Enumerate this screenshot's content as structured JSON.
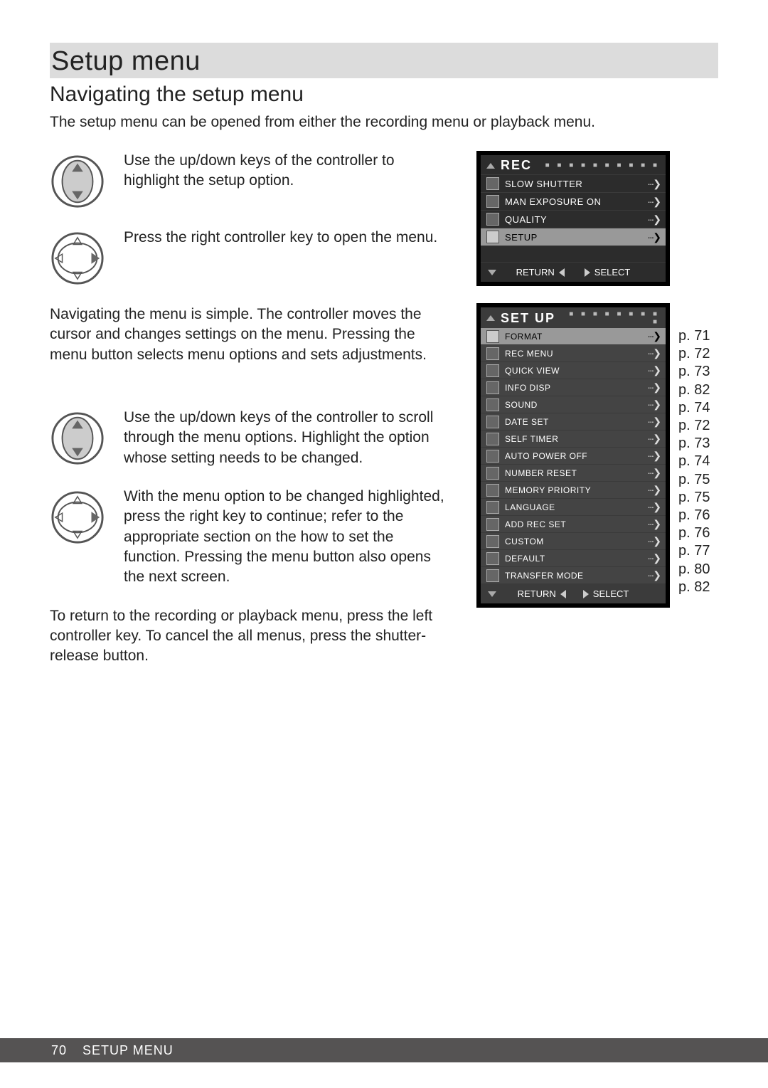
{
  "page": {
    "title": "Setup menu",
    "subtitle": "Navigating the setup menu",
    "intro": "The setup menu can be opened from either the recording menu or playback menu.",
    "step1": "Use the up/down keys of the controller to highlight the setup option.",
    "step2": "Press the right controller key to open the menu.",
    "para1": "Navigating the menu is simple. The controller moves the cursor and changes settings on the menu. Pressing the menu button selects menu options and sets adjustments.",
    "step3": "Use the up/down keys of the controller to scroll through the menu options. Highlight the option whose setting needs to be changed.",
    "step4": "With the menu option to be changed highlighted, press the right key to continue; refer to the appropriate section on the how to set the function. Pressing the menu button also opens the next screen.",
    "para2": "To return to the recording or playback menu, press the left controller key. To cancel the all menus, press the shutter-release button."
  },
  "rec_menu": {
    "title": "REC",
    "items": [
      {
        "label": "SLOW SHUTTER",
        "selected": false
      },
      {
        "label": "MAN EXPOSURE ON",
        "selected": false
      },
      {
        "label": "QUALITY",
        "selected": false
      },
      {
        "label": "SETUP",
        "selected": true
      }
    ],
    "footer_return": "RETURN",
    "footer_select": "SELECT"
  },
  "setup_menu": {
    "title": "SET UP",
    "items": [
      {
        "label": "FORMAT",
        "page": "p. 71",
        "selected": true
      },
      {
        "label": "REC MENU",
        "page": "p. 72",
        "selected": false
      },
      {
        "label": "QUICK VIEW",
        "page": "p. 73",
        "selected": false
      },
      {
        "label": "INFO DISP",
        "page": "p. 82",
        "selected": false
      },
      {
        "label": "SOUND",
        "page": "p. 74",
        "selected": false
      },
      {
        "label": "DATE SET",
        "page": "p. 72",
        "selected": false
      },
      {
        "label": "SELF TIMER",
        "page": "p. 73",
        "selected": false
      },
      {
        "label": "AUTO POWER OFF",
        "page": "p. 74",
        "selected": false
      },
      {
        "label": "NUMBER RESET",
        "page": "p. 75",
        "selected": false
      },
      {
        "label": "MEMORY PRIORITY",
        "page": "p. 75",
        "selected": false
      },
      {
        "label": "LANGUAGE",
        "page": "p. 76",
        "selected": false
      },
      {
        "label": "ADD REC SET",
        "page": "p. 76",
        "selected": false
      },
      {
        "label": "CUSTOM",
        "page": "p. 77",
        "selected": false
      },
      {
        "label": "DEFAULT",
        "page": "p. 80",
        "selected": false
      },
      {
        "label": "TRANSFER MODE",
        "page": "p. 82",
        "selected": false
      }
    ],
    "footer_return": "RETURN",
    "footer_select": "SELECT"
  },
  "footer": {
    "page_number": "70",
    "section": "SETUP MENU"
  },
  "glyphs": {
    "arrow_more": "···❯"
  }
}
